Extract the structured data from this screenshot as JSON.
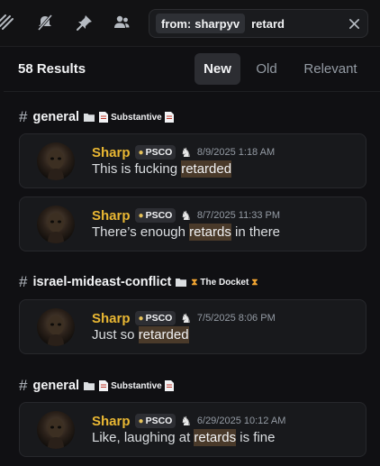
{
  "toolbar": {
    "icons": [
      "threads-icon",
      "mute-icon",
      "pin-icon",
      "members-icon"
    ]
  },
  "search": {
    "filter_label": "from:",
    "filter_value": "sharpyv",
    "query": "retard",
    "clear_icon": "close-icon"
  },
  "results": {
    "count_label": "58 Results",
    "sort_tabs": [
      {
        "label": "New",
        "active": true
      },
      {
        "label": "Old",
        "active": false
      },
      {
        "label": "Relevant",
        "active": false
      }
    ]
  },
  "groups": [
    {
      "channel": "general",
      "category": "Substantive",
      "messages": [
        {
          "author": "Sharp",
          "tag": "PSCO",
          "timestamp": "8/9/2025 1:18 AM",
          "text_before": "This is fucking ",
          "highlight": "retarded",
          "text_after": ""
        },
        {
          "author": "Sharp",
          "tag": "PSCO",
          "timestamp": "8/7/2025 11:33 PM",
          "text_before": "There’s enough ",
          "highlight": "retards",
          "text_after": " in there"
        }
      ]
    },
    {
      "channel": "israel-mideast-conflict",
      "category": "The Docket",
      "messages": [
        {
          "author": "Sharp",
          "tag": "PSCO",
          "timestamp": "7/5/2025 8:06 PM",
          "text_before": "Just so ",
          "highlight": "retarded",
          "text_after": ""
        }
      ]
    },
    {
      "channel": "general",
      "category": "Substantive",
      "messages": [
        {
          "author": "Sharp",
          "tag": "PSCO",
          "timestamp": "6/29/2025 10:12 AM",
          "text_before": "Like, laughing at ",
          "highlight": "retards",
          "text_after": " is fine"
        }
      ]
    }
  ],
  "colors": {
    "author": "#e9b733",
    "highlight_bg": "#4a3a2a",
    "background": "#101013",
    "card": "#18191c"
  }
}
